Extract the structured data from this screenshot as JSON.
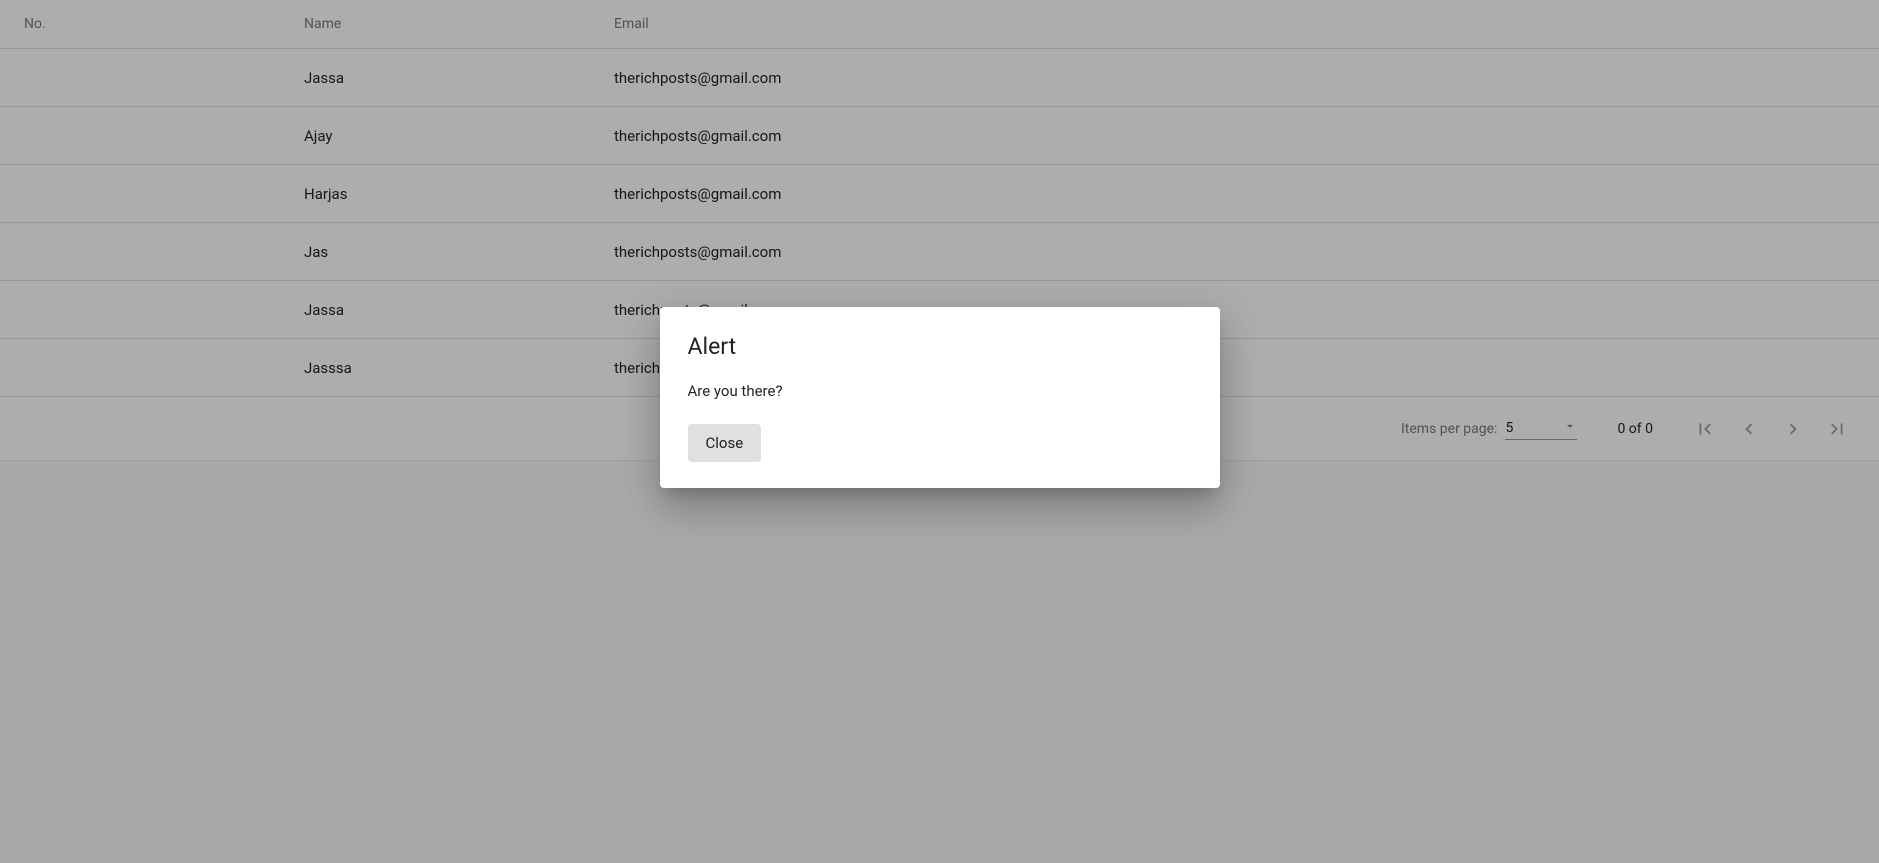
{
  "table": {
    "headers": {
      "no": "No.",
      "name": "Name",
      "email": "Email"
    },
    "rows": [
      {
        "no": "",
        "name": "Jassa",
        "email": "therichposts@gmail.com"
      },
      {
        "no": "",
        "name": "Ajay",
        "email": "therichposts@gmail.com"
      },
      {
        "no": "",
        "name": "Harjas",
        "email": "therichposts@gmail.com"
      },
      {
        "no": "",
        "name": "Jas",
        "email": "therichposts@gmail.com"
      },
      {
        "no": "",
        "name": "Jassa",
        "email": "therichposts@gmail.com"
      },
      {
        "no": "",
        "name": "Jasssa",
        "email": "therichposts@gmail.com"
      }
    ]
  },
  "paginator": {
    "items_per_page_label": "Items per page:",
    "page_size": "5",
    "range_label": "0 of 0"
  },
  "dialog": {
    "title": "Alert",
    "message": "Are you there?",
    "close_label": "Close"
  }
}
